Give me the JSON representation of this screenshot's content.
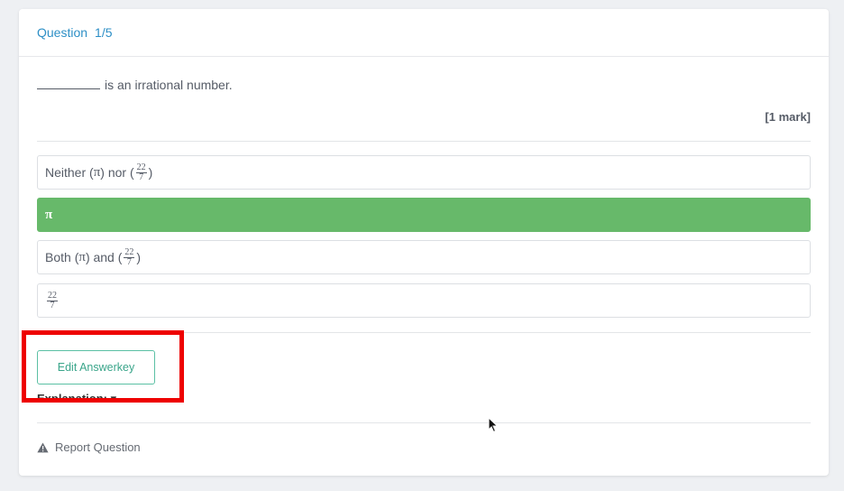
{
  "header": {
    "label": "Question",
    "number": "1/5"
  },
  "question": {
    "text": "is an irrational number.",
    "marks": "[1 mark]"
  },
  "options": [
    {
      "pre": "Neither (",
      "pi": "π",
      "mid": ") nor (",
      "frac_num": "22",
      "frac_den": "7",
      "post": ")",
      "correct": false
    },
    {
      "label": "π",
      "correct": true
    },
    {
      "pre": "Both (",
      "pi": "π",
      "mid": ") and (",
      "frac_num": "22",
      "frac_den": "7",
      "post": ")",
      "correct": false
    },
    {
      "frac_num": "22",
      "frac_den": "7",
      "correct": false
    }
  ],
  "edit_button": {
    "label": "Edit Answerkey"
  },
  "explanation": {
    "label": "Explanation: ▾"
  },
  "report": {
    "label": "Report Question",
    "icon": "warning-triangle-icon"
  },
  "colors": {
    "accent_blue": "#2d8fc6",
    "correct_green": "#67b96a",
    "button_teal": "#3aa58a",
    "highlight_red": "#ee0000"
  }
}
